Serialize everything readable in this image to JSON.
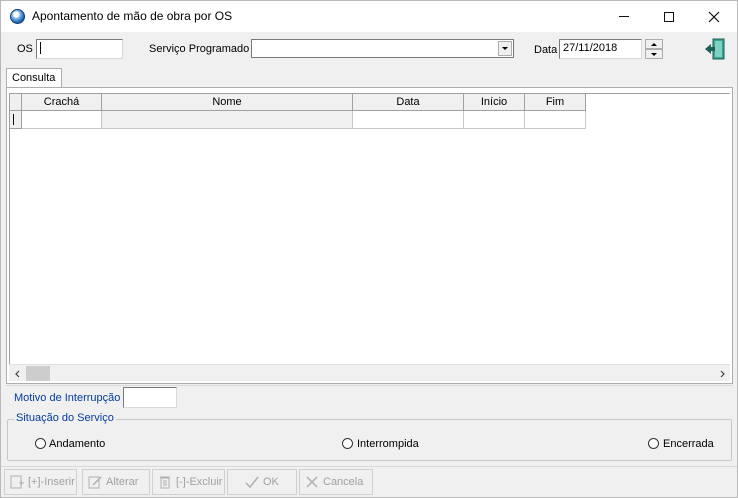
{
  "window": {
    "title": "Apontamento de mão de obra por OS"
  },
  "filters": {
    "os_label": "OS",
    "os_value": "",
    "servico_label": "Serviço Programado",
    "servico_value": "",
    "data_label": "Data",
    "data_value": "27/11/2018"
  },
  "tabs": [
    {
      "label": "Consulta",
      "active": true
    }
  ],
  "grid": {
    "columns": [
      "Crachá",
      "Nome",
      "Data",
      "Início",
      "Fim"
    ],
    "rows": [
      [
        "",
        "",
        "",
        "",
        ""
      ]
    ]
  },
  "motivo": {
    "label": "Motivo de Interrupção",
    "value": ""
  },
  "situacao": {
    "title": "Situação do Serviço",
    "options": [
      {
        "label": "Andamento",
        "selected": false
      },
      {
        "label": "Interrompida",
        "selected": false
      },
      {
        "label": "Encerrada",
        "selected": false
      }
    ]
  },
  "toolbar": {
    "inserir": "[+]-Inserir",
    "alterar": "Alterar",
    "excluir": "[-]-Excluir",
    "ok": "OK",
    "cancela": "Cancela"
  },
  "colors": {
    "accent_label": "#003c9e",
    "disabled_text": "#a0a0a0",
    "exit_icon": "#2a8a7c"
  },
  "icons": {
    "exit": "exit-door-icon",
    "inserir": "add-record-icon",
    "alterar": "edit-record-icon",
    "excluir": "trash-icon",
    "ok": "checkmark-icon",
    "cancela": "cancel-x-icon"
  }
}
